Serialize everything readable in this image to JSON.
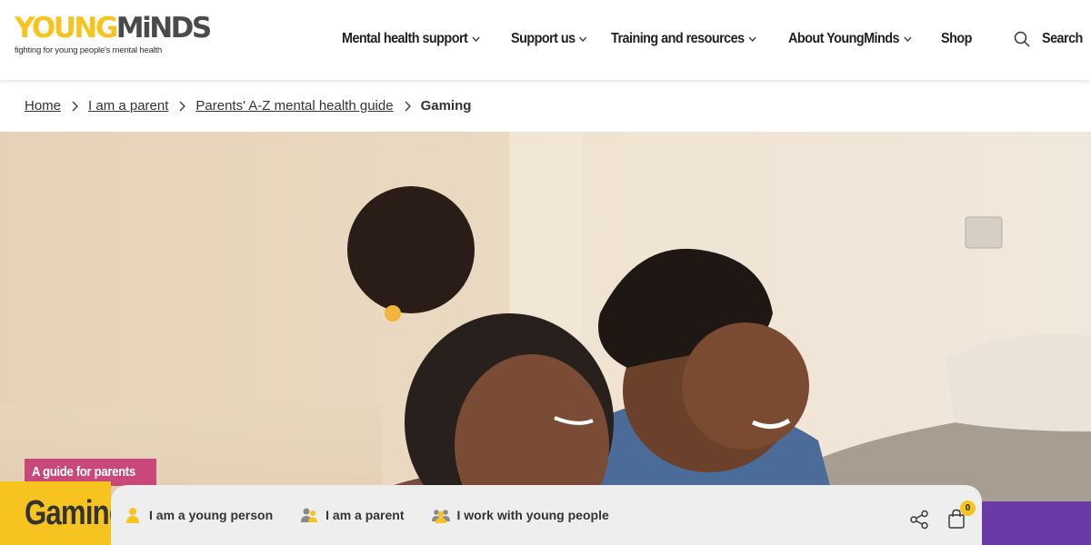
{
  "header": {
    "logo": {
      "word_part1": "YOUNG",
      "word_part2": "MiNDS",
      "tagline": "fighting for young people's mental health"
    },
    "nav": [
      {
        "label": "Mental health support",
        "has_dropdown": true
      },
      {
        "label": "Support us",
        "has_dropdown": true
      },
      {
        "label": "Training and resources",
        "has_dropdown": true
      },
      {
        "label": "About YoungMinds",
        "has_dropdown": true
      },
      {
        "label": "Shop",
        "has_dropdown": false
      }
    ],
    "search_label": "Search"
  },
  "breadcrumb": {
    "items": [
      "Home",
      "I am a parent",
      "Parents' A-Z mental health guide"
    ],
    "current": "Gaming"
  },
  "hero": {
    "tag": "A guide for parents",
    "title": "Gaming"
  },
  "audience_bar": {
    "items": [
      {
        "label": "I am a young person",
        "icon": "person-icon"
      },
      {
        "label": "I am a parent",
        "icon": "people-icon"
      },
      {
        "label": "I work with young people",
        "icon": "group-icon"
      }
    ],
    "basket_count": "0"
  },
  "colors": {
    "brand_yellow": "#f7c31f",
    "brand_pink": "#c84879",
    "brand_purple": "#6a3aa6",
    "text_dark": "#333333"
  }
}
